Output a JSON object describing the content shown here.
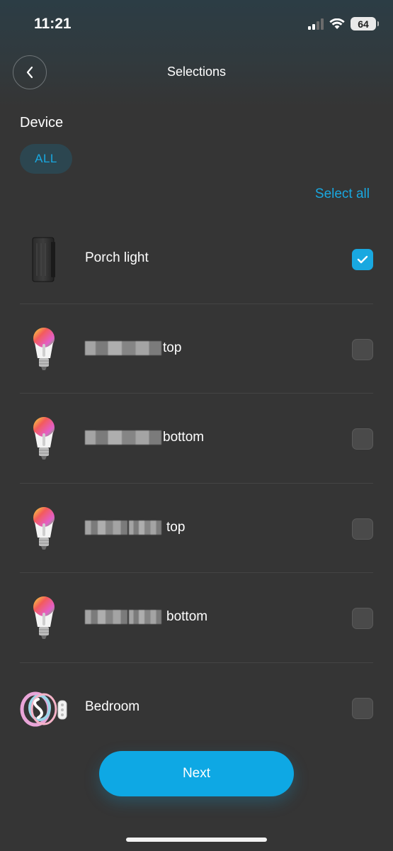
{
  "status_bar": {
    "time": "11:21",
    "battery": "64"
  },
  "header": {
    "title": "Selections"
  },
  "section": {
    "label": "Device",
    "filter_chip": "ALL",
    "select_all": "Select all"
  },
  "devices": [
    {
      "name": "Porch light",
      "icon": "wall-panel-device-icon",
      "checked": true
    },
    {
      "name": "top",
      "icon": "rgb-bulb-icon",
      "checked": false,
      "redacted": true
    },
    {
      "name": "bottom",
      "icon": "rgb-bulb-icon",
      "checked": false,
      "redacted": true
    },
    {
      "name": "top",
      "icon": "rgb-bulb-icon",
      "checked": false,
      "redacted": true
    },
    {
      "name": "bottom",
      "icon": "rgb-bulb-icon",
      "checked": false,
      "redacted": true
    },
    {
      "name": "Bedroom",
      "icon": "led-strip-icon",
      "checked": false
    }
  ],
  "actions": {
    "next_label": "Next"
  },
  "colors": {
    "accent": "#19a8e0",
    "background": "#353535",
    "checkbox_off": "#4a4a4a"
  }
}
